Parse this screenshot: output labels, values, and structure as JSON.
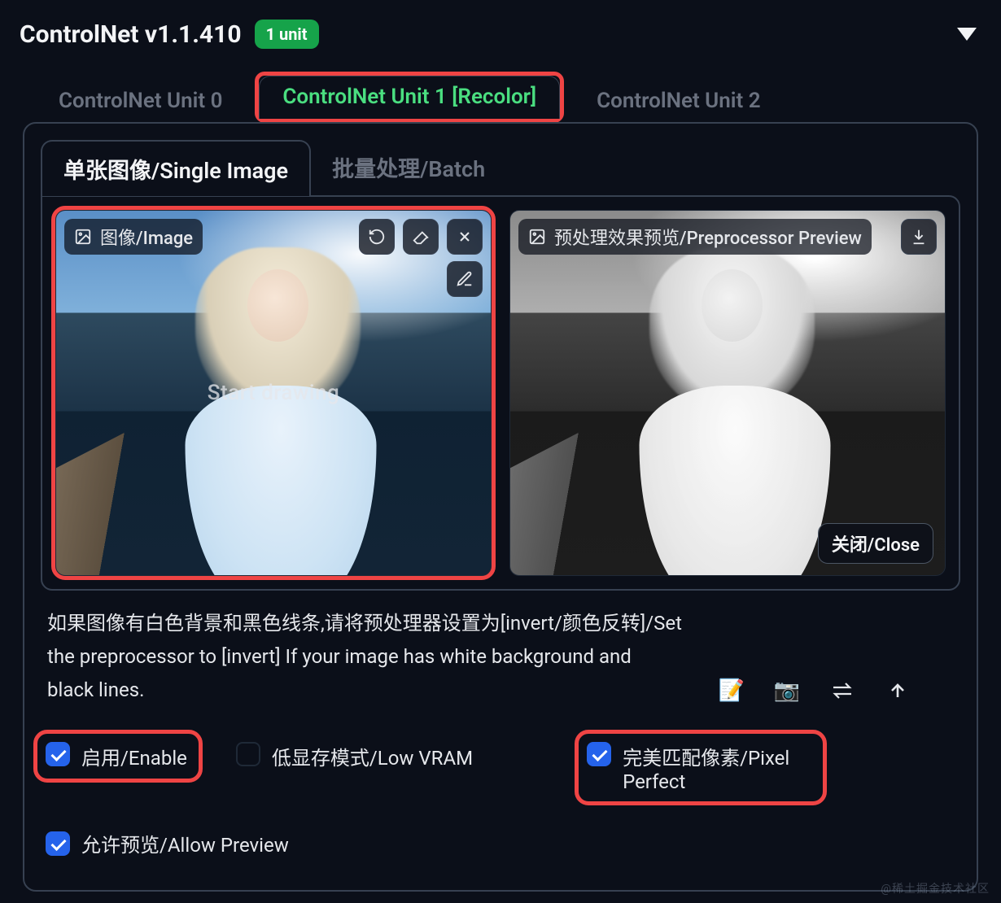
{
  "header": {
    "title": "ControlNet v1.1.410",
    "badge": "1 unit"
  },
  "tabs": [
    {
      "label": "ControlNet Unit 0",
      "active": false
    },
    {
      "label": "ControlNet Unit 1 [Recolor]",
      "active": true
    },
    {
      "label": "ControlNet Unit 2",
      "active": false
    }
  ],
  "inner_tabs": [
    {
      "label": "单张图像/Single Image",
      "active": true
    },
    {
      "label": "批量处理/Batch",
      "active": false
    }
  ],
  "image_slot": {
    "label": "图像/Image",
    "overlay": "Start drawing"
  },
  "preview_slot": {
    "label": "预处理效果预览/Preprocessor Preview",
    "close": "关闭/Close"
  },
  "hint": "如果图像有白色背景和黑色线条,请将预处理器设置为[invert/颜色反转]/Set the preprocessor to [invert] If your image has white background and black lines.",
  "checks": {
    "enable": "启用/Enable",
    "low_vram": "低显存模式/Low VRAM",
    "pixel_perfect": "完美匹配像素/Pixel Perfect",
    "allow_preview": "允许预览/Allow Preview"
  },
  "tool_icons": {
    "new_canvas": "📝",
    "camera": "📷",
    "swap": "⇄",
    "send": "↥"
  },
  "watermark": "@稀土掘金技术社区"
}
